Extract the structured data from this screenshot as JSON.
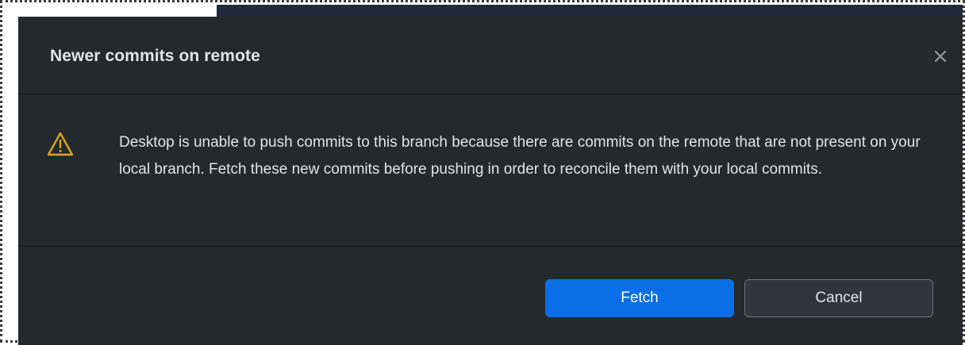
{
  "dialog": {
    "title": "Newer commits on remote",
    "close_icon": "close-icon",
    "warning_icon": "warning-triangle-icon",
    "message": "Desktop is unable to push commits to this branch because there are commits on the remote that are not present on your local branch. Fetch these new commits before pushing in order to reconcile them with your local commits.",
    "buttons": {
      "primary_label": "Fetch",
      "secondary_label": "Cancel"
    }
  },
  "colors": {
    "dialog_background": "#24292e",
    "primary_button": "#0a6ee6",
    "warning": "#d9a520",
    "text": "#e1e4e8"
  }
}
